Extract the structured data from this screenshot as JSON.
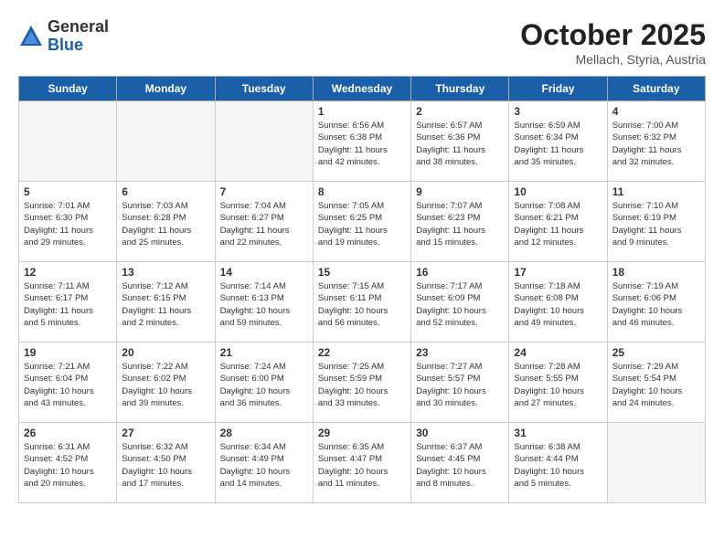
{
  "header": {
    "logo_general": "General",
    "logo_blue": "Blue",
    "month": "October 2025",
    "location": "Mellach, Styria, Austria"
  },
  "days_of_week": [
    "Sunday",
    "Monday",
    "Tuesday",
    "Wednesday",
    "Thursday",
    "Friday",
    "Saturday"
  ],
  "weeks": [
    [
      {
        "day": "",
        "info": "",
        "empty": true
      },
      {
        "day": "",
        "info": "",
        "empty": true
      },
      {
        "day": "",
        "info": "",
        "empty": true
      },
      {
        "day": "1",
        "info": "Sunrise: 6:56 AM\nSunset: 6:38 PM\nDaylight: 11 hours\nand 42 minutes.",
        "empty": false
      },
      {
        "day": "2",
        "info": "Sunrise: 6:57 AM\nSunset: 6:36 PM\nDaylight: 11 hours\nand 38 minutes.",
        "empty": false
      },
      {
        "day": "3",
        "info": "Sunrise: 6:59 AM\nSunset: 6:34 PM\nDaylight: 11 hours\nand 35 minutes.",
        "empty": false
      },
      {
        "day": "4",
        "info": "Sunrise: 7:00 AM\nSunset: 6:32 PM\nDaylight: 11 hours\nand 32 minutes.",
        "empty": false
      }
    ],
    [
      {
        "day": "5",
        "info": "Sunrise: 7:01 AM\nSunset: 6:30 PM\nDaylight: 11 hours\nand 29 minutes.",
        "empty": false
      },
      {
        "day": "6",
        "info": "Sunrise: 7:03 AM\nSunset: 6:28 PM\nDaylight: 11 hours\nand 25 minutes.",
        "empty": false
      },
      {
        "day": "7",
        "info": "Sunrise: 7:04 AM\nSunset: 6:27 PM\nDaylight: 11 hours\nand 22 minutes.",
        "empty": false
      },
      {
        "day": "8",
        "info": "Sunrise: 7:05 AM\nSunset: 6:25 PM\nDaylight: 11 hours\nand 19 minutes.",
        "empty": false
      },
      {
        "day": "9",
        "info": "Sunrise: 7:07 AM\nSunset: 6:23 PM\nDaylight: 11 hours\nand 15 minutes.",
        "empty": false
      },
      {
        "day": "10",
        "info": "Sunrise: 7:08 AM\nSunset: 6:21 PM\nDaylight: 11 hours\nand 12 minutes.",
        "empty": false
      },
      {
        "day": "11",
        "info": "Sunrise: 7:10 AM\nSunset: 6:19 PM\nDaylight: 11 hours\nand 9 minutes.",
        "empty": false
      }
    ],
    [
      {
        "day": "12",
        "info": "Sunrise: 7:11 AM\nSunset: 6:17 PM\nDaylight: 11 hours\nand 5 minutes.",
        "empty": false
      },
      {
        "day": "13",
        "info": "Sunrise: 7:12 AM\nSunset: 6:15 PM\nDaylight: 11 hours\nand 2 minutes.",
        "empty": false
      },
      {
        "day": "14",
        "info": "Sunrise: 7:14 AM\nSunset: 6:13 PM\nDaylight: 10 hours\nand 59 minutes.",
        "empty": false
      },
      {
        "day": "15",
        "info": "Sunrise: 7:15 AM\nSunset: 6:11 PM\nDaylight: 10 hours\nand 56 minutes.",
        "empty": false
      },
      {
        "day": "16",
        "info": "Sunrise: 7:17 AM\nSunset: 6:09 PM\nDaylight: 10 hours\nand 52 minutes.",
        "empty": false
      },
      {
        "day": "17",
        "info": "Sunrise: 7:18 AM\nSunset: 6:08 PM\nDaylight: 10 hours\nand 49 minutes.",
        "empty": false
      },
      {
        "day": "18",
        "info": "Sunrise: 7:19 AM\nSunset: 6:06 PM\nDaylight: 10 hours\nand 46 minutes.",
        "empty": false
      }
    ],
    [
      {
        "day": "19",
        "info": "Sunrise: 7:21 AM\nSunset: 6:04 PM\nDaylight: 10 hours\nand 43 minutes.",
        "empty": false
      },
      {
        "day": "20",
        "info": "Sunrise: 7:22 AM\nSunset: 6:02 PM\nDaylight: 10 hours\nand 39 minutes.",
        "empty": false
      },
      {
        "day": "21",
        "info": "Sunrise: 7:24 AM\nSunset: 6:00 PM\nDaylight: 10 hours\nand 36 minutes.",
        "empty": false
      },
      {
        "day": "22",
        "info": "Sunrise: 7:25 AM\nSunset: 5:59 PM\nDaylight: 10 hours\nand 33 minutes.",
        "empty": false
      },
      {
        "day": "23",
        "info": "Sunrise: 7:27 AM\nSunset: 5:57 PM\nDaylight: 10 hours\nand 30 minutes.",
        "empty": false
      },
      {
        "day": "24",
        "info": "Sunrise: 7:28 AM\nSunset: 5:55 PM\nDaylight: 10 hours\nand 27 minutes.",
        "empty": false
      },
      {
        "day": "25",
        "info": "Sunrise: 7:29 AM\nSunset: 5:54 PM\nDaylight: 10 hours\nand 24 minutes.",
        "empty": false
      }
    ],
    [
      {
        "day": "26",
        "info": "Sunrise: 6:31 AM\nSunset: 4:52 PM\nDaylight: 10 hours\nand 20 minutes.",
        "empty": false
      },
      {
        "day": "27",
        "info": "Sunrise: 6:32 AM\nSunset: 4:50 PM\nDaylight: 10 hours\nand 17 minutes.",
        "empty": false
      },
      {
        "day": "28",
        "info": "Sunrise: 6:34 AM\nSunset: 4:49 PM\nDaylight: 10 hours\nand 14 minutes.",
        "empty": false
      },
      {
        "day": "29",
        "info": "Sunrise: 6:35 AM\nSunset: 4:47 PM\nDaylight: 10 hours\nand 11 minutes.",
        "empty": false
      },
      {
        "day": "30",
        "info": "Sunrise: 6:37 AM\nSunset: 4:45 PM\nDaylight: 10 hours\nand 8 minutes.",
        "empty": false
      },
      {
        "day": "31",
        "info": "Sunrise: 6:38 AM\nSunset: 4:44 PM\nDaylight: 10 hours\nand 5 minutes.",
        "empty": false
      },
      {
        "day": "",
        "info": "",
        "empty": true
      }
    ]
  ]
}
